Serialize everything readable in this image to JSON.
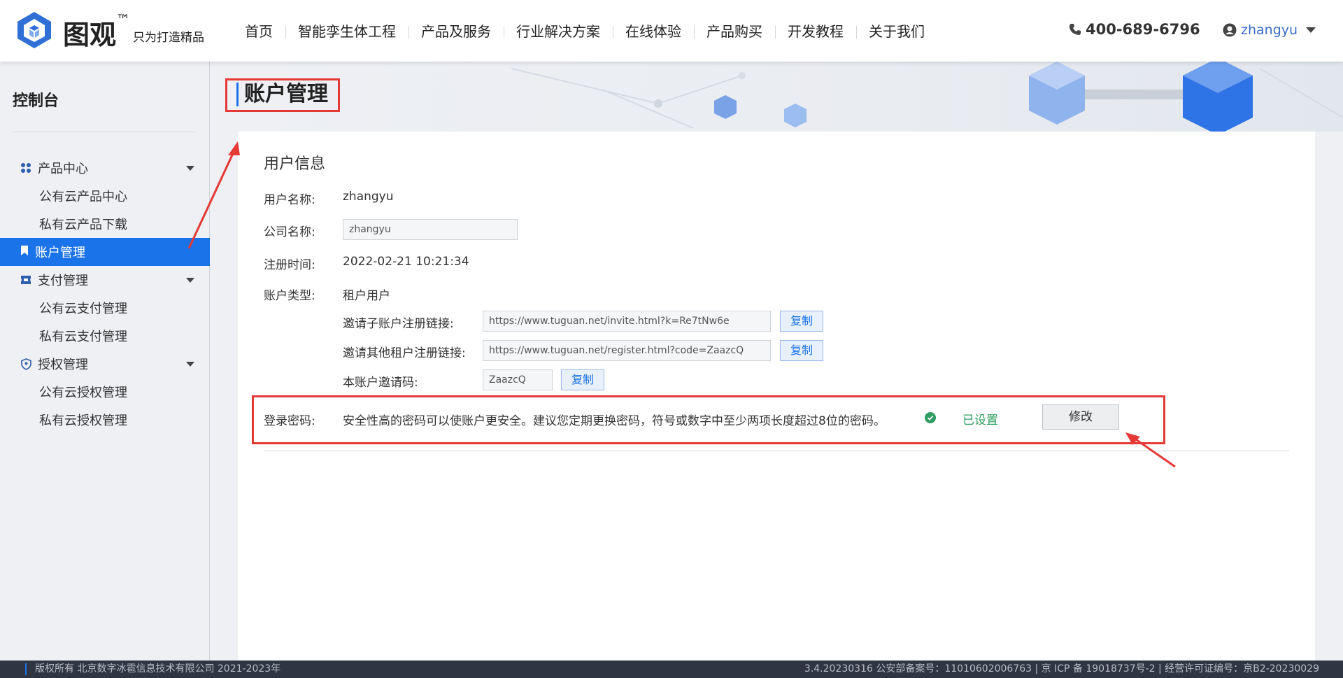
{
  "header": {
    "logo_name": "图观",
    "logo_tm": "™",
    "logo_slogan": "只为打造精品",
    "nav": [
      "首页",
      "智能孪生体工程",
      "产品及服务",
      "行业解决方案",
      "在线体验",
      "产品购买",
      "开发教程",
      "关于我们"
    ],
    "phone": "400-689-6796",
    "username": "zhangyu"
  },
  "sidebar": {
    "title": "控制台",
    "groups": [
      {
        "label": "产品中心",
        "icon": "grid-icon",
        "items": [
          "公有云产品中心",
          "私有云产品下载"
        ]
      },
      {
        "label": "账户管理",
        "icon": "bookmark-icon",
        "active": true
      },
      {
        "label": "支付管理",
        "icon": "ticket-icon",
        "items": [
          "公有云支付管理",
          "私有云支付管理"
        ]
      },
      {
        "label": "授权管理",
        "icon": "shield-icon",
        "items": [
          "公有云授权管理",
          "私有云授权管理"
        ]
      }
    ]
  },
  "main": {
    "page_title": "账户管理",
    "section_title": "用户信息",
    "username_label": "用户名称:",
    "username_value": "zhangyu",
    "company_label": "公司名称:",
    "company_value": "zhangyu",
    "register_label": "注册时间:",
    "register_value": "2022-02-21 10:21:34",
    "account_type_label": "账户类型:",
    "account_type_value": "租户用户",
    "invite_sub_label": "邀请子账户注册链接:",
    "invite_sub_value": "https://www.tuguan.net/invite.html?k=Re7tNw6e",
    "invite_tenant_label": "邀请其他租户注册链接:",
    "invite_tenant_value": "https://www.tuguan.net/register.html?code=ZaazcQ",
    "invite_code_label": "本账户邀请码:",
    "invite_code_value": "ZaazcQ",
    "copy_label": "复制",
    "password_label": "登录密码:",
    "password_desc": "安全性高的密码可以使账户更安全。建议您定期更换密码，符号或数字中至少两项长度超过8位的密码。",
    "password_status": "已设置",
    "modify_label": "修改"
  },
  "footer": {
    "left": "版权所有 北京数字冰雹信息技术有限公司 2021-2023年",
    "right": "3.4.20230316 公安部备案号：11010602006763 | 京 ICP 备 19018737号-2 | 经营许可证编号：京B2-20230029"
  },
  "colors": {
    "accent": "#1a73e8",
    "highlight": "#e53935",
    "success": "#2e9e62",
    "footer_bg": "#2f3542"
  }
}
